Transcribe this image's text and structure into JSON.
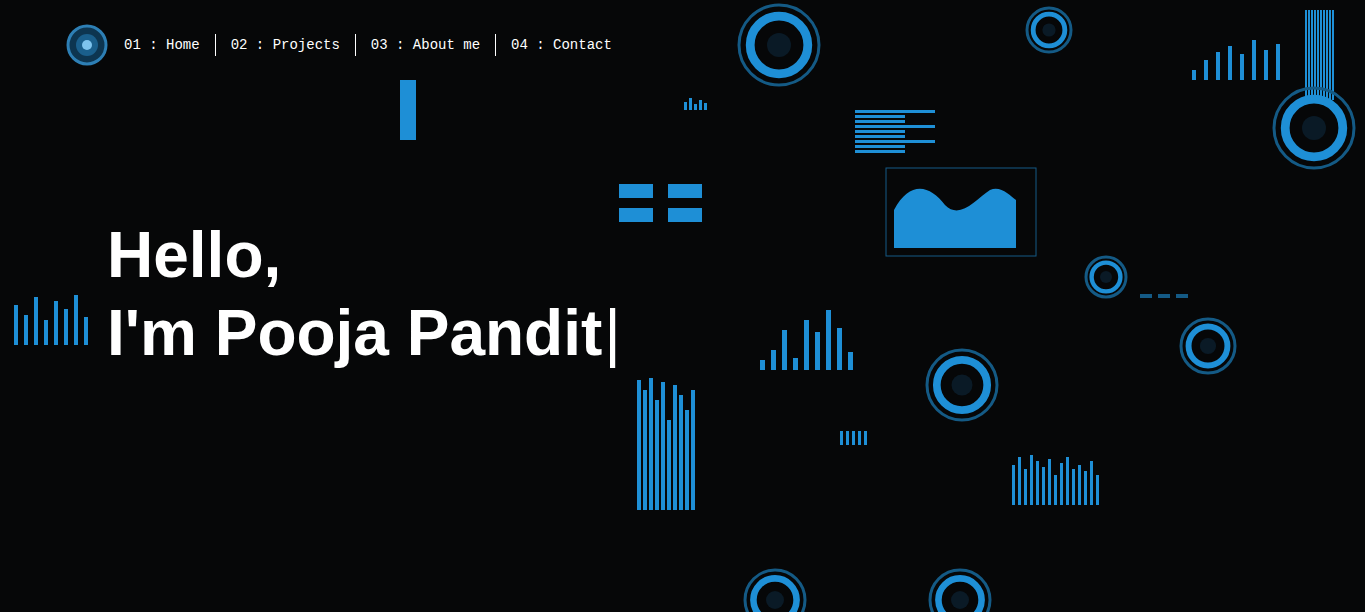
{
  "nav": {
    "items": [
      {
        "label": "01 : Home"
      },
      {
        "label": "02 : Projects"
      },
      {
        "label": "03 : About me"
      },
      {
        "label": "04 : Contact"
      }
    ]
  },
  "hero": {
    "lines": [
      "Hello,",
      "I'm Pooja Pandit"
    ],
    "cursor": "|"
  }
}
